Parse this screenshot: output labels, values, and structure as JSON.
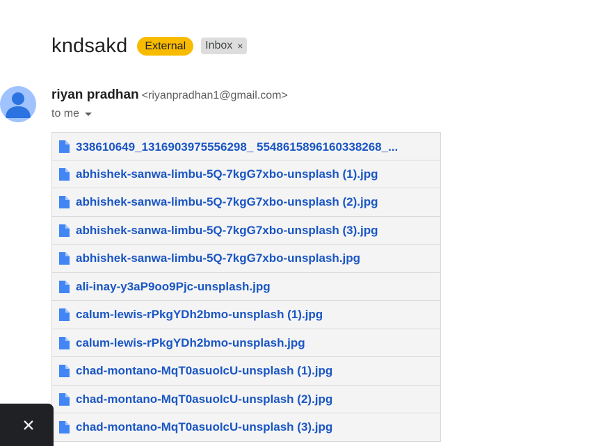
{
  "header": {
    "subject": "kndsakd",
    "external_label": "External",
    "inbox_label": "Inbox",
    "inbox_remove": "×"
  },
  "message": {
    "sender_name": "riyan pradhan",
    "sender_email": "<riyanpradhan1@gmail.com>",
    "recipient_label": "to me"
  },
  "attachments": [
    "338610649_1316903975556298_ 5548615896160338268_...",
    "abhishek-sanwa-limbu-5Q-7kgG7xbo-unsplash (1).jpg",
    "abhishek-sanwa-limbu-5Q-7kgG7xbo-unsplash (2).jpg",
    "abhishek-sanwa-limbu-5Q-7kgG7xbo-unsplash (3).jpg",
    "abhishek-sanwa-limbu-5Q-7kgG7xbo-unsplash.jpg",
    "ali-inay-y3aP9oo9Pjc-unsplash.jpg",
    "calum-lewis-rPkgYDh2bmo-unsplash (1).jpg",
    "calum-lewis-rPkgYDh2bmo-unsplash.jpg",
    "chad-montano-MqT0asuoIcU-unsplash (1).jpg",
    "chad-montano-MqT0asuoIcU-unsplash (2).jpg",
    "chad-montano-MqT0asuoIcU-unsplash (3).jpg"
  ],
  "colors": {
    "external_badge": "#f9bb00",
    "inbox_badge": "#dddddd",
    "link_blue": "#1a56c4",
    "file_icon_blue": "#4285f4",
    "avatar_bg": "#a0c3ff",
    "avatar_fg": "#2b73e0"
  },
  "icons": {
    "attachment": "file-icon",
    "avatar": "person-icon",
    "recipient_toggle": "caret-down-icon",
    "toast_close": "close-icon"
  }
}
